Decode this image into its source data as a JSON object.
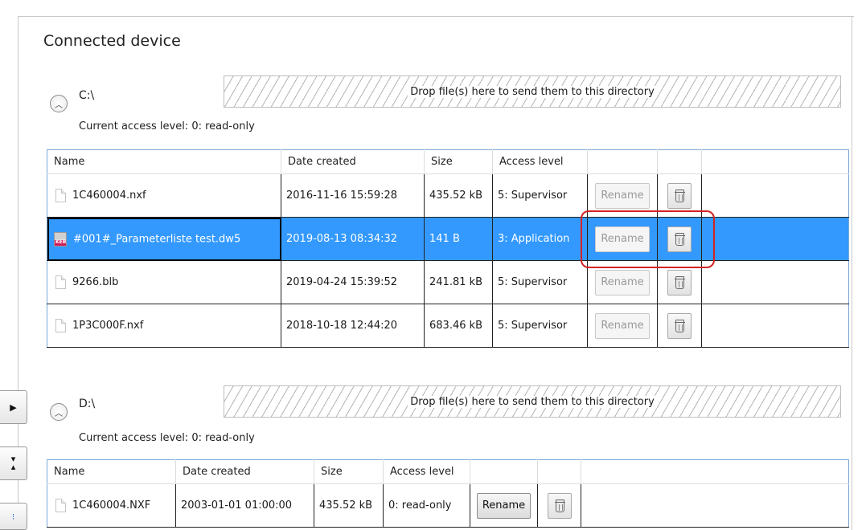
{
  "title": "Connected device",
  "drives": [
    {
      "path": "C:\\",
      "dropzone_text": "Drop file(s) here to send them to this directory",
      "access_text": "Current access level: 0: read-only",
      "columns": [
        "Name",
        "Date created",
        "Size",
        "Access level"
      ],
      "files": [
        {
          "name": "1C460004.nxf",
          "date": "2016-11-16 15:59:28",
          "size": "435.52 kB",
          "access": "5: Supervisor",
          "rename": "Rename",
          "icon": "file-icon",
          "selected": false
        },
        {
          "name": "#001#_Parameterliste test.dw5",
          "date": "2019-08-13 08:34:32",
          "size": "141 B",
          "access": "3: Application",
          "rename": "Rename",
          "icon": "keb-icon",
          "selected": true
        },
        {
          "name": "9266.blb",
          "date": "2019-04-24 15:39:52",
          "size": "241.81 kB",
          "access": "5: Supervisor",
          "rename": "Rename",
          "icon": "file-icon",
          "selected": false
        },
        {
          "name": "1P3C000F.nxf",
          "date": "2018-10-18 12:44:20",
          "size": "683.46 kB",
          "access": "5: Supervisor",
          "rename": "Rename",
          "icon": "file-icon",
          "selected": false
        }
      ]
    },
    {
      "path": "D:\\",
      "dropzone_text": "Drop file(s) here to send them to this directory",
      "access_text": "Current access level: 0: read-only",
      "columns": [
        "Name",
        "Date created",
        "Size",
        "Access level"
      ],
      "files": [
        {
          "name": "1C460004.NXF",
          "date": "2003-01-01 01:00:00",
          "size": "435.52 kB",
          "access": "0: read-only",
          "rename": "Rename",
          "icon": "file-icon",
          "selected": false
        }
      ]
    }
  ],
  "keb_icon_text": "KEB",
  "colors": {
    "selection": "#3399ff",
    "highlight": "#d42323",
    "table_border": "#7aa7d6"
  }
}
